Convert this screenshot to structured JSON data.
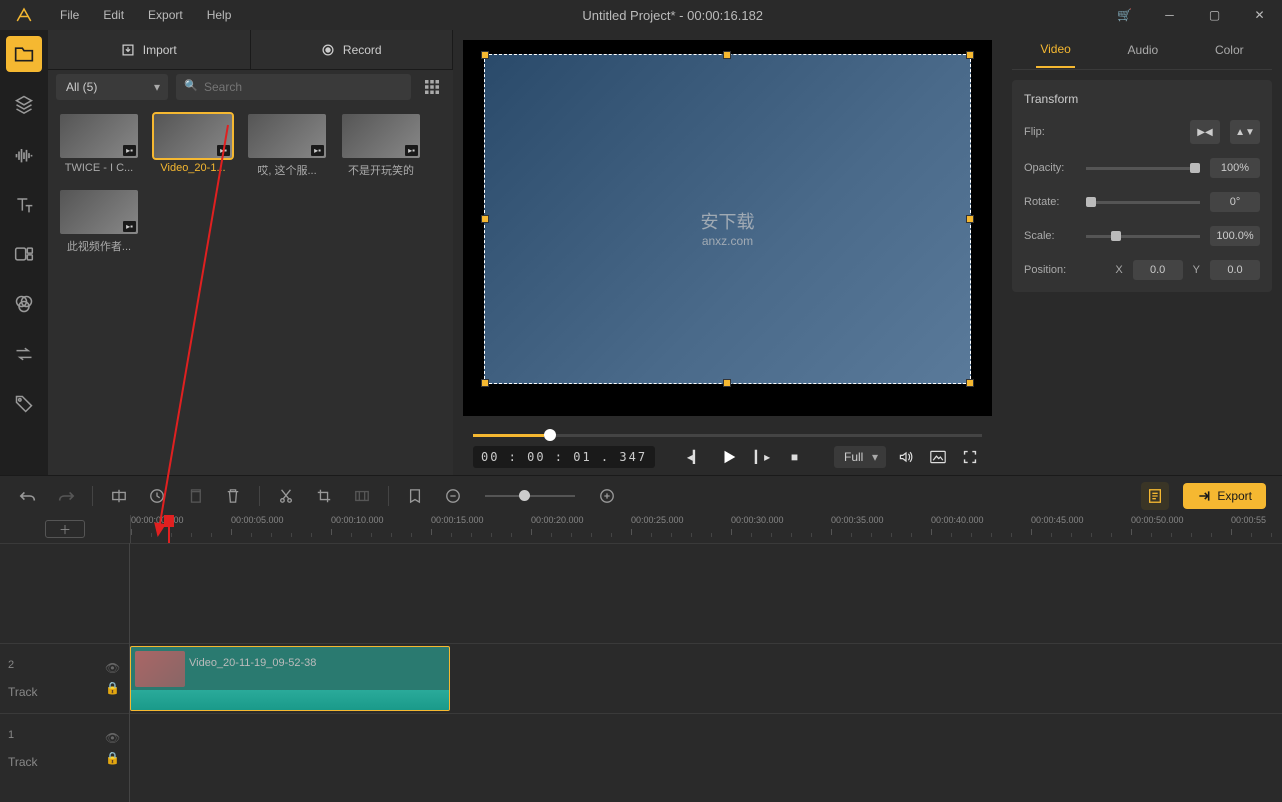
{
  "title": "Untitled Project* - 00:00:16.182",
  "menu": {
    "file": "File",
    "edit": "Edit",
    "export": "Export",
    "help": "Help"
  },
  "media": {
    "import": "Import",
    "record": "Record",
    "filter": "All (5)",
    "search_ph": "Search",
    "items": [
      {
        "label": "TWICE - I C..."
      },
      {
        "label": "Video_20-1..."
      },
      {
        "label": "哎, 这个服..."
      },
      {
        "label": "不是开玩笑的"
      },
      {
        "label": "此视频作者..."
      }
    ]
  },
  "preview": {
    "timecode": "00 : 00 : 01 . 347",
    "view_mode": "Full",
    "watermark_top": "安下载",
    "watermark_bottom": "anxz.com"
  },
  "props": {
    "tabs": {
      "video": "Video",
      "audio": "Audio",
      "color": "Color"
    },
    "transform": "Transform",
    "flip": "Flip:",
    "opacity": "Opacity:",
    "opacity_val": "100%",
    "rotate": "Rotate:",
    "rotate_val": "0°",
    "scale": "Scale:",
    "scale_val": "100.0%",
    "position": "Position:",
    "x_lbl": "X",
    "x_val": "0.0",
    "y_lbl": "Y",
    "y_val": "0.0"
  },
  "export_btn": "Export",
  "timeline": {
    "ticks": [
      "00:00:00.000",
      "00:00:05.000",
      "00:00:10.000",
      "00:00:15.000",
      "00:00:20.000",
      "00:00:25.000",
      "00:00:30.000",
      "00:00:35.000",
      "00:00:40.000",
      "00:00:45.000",
      "00:00:50.000",
      "00:00:55"
    ],
    "tracks": [
      {
        "num": "2",
        "label": "Track"
      },
      {
        "num": "1",
        "label": "Track"
      }
    ],
    "clip_label": "Video_20-11-19_09-52-38"
  }
}
